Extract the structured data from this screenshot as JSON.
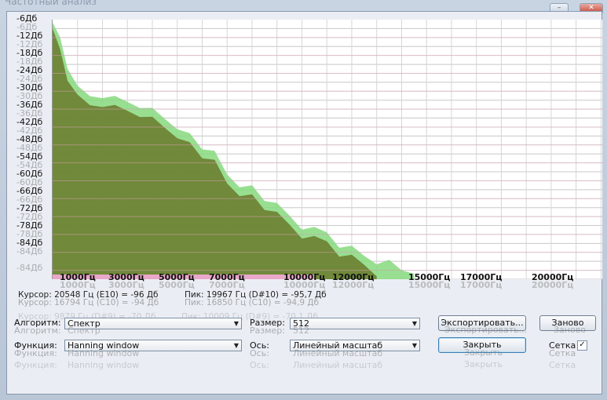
{
  "window": {
    "title": "Частотный анализ",
    "min_glyph": "–",
    "close_glyph": "✕"
  },
  "y_axis": {
    "labels": [
      "-6Дб",
      "-12Дб",
      "-18Дб",
      "-24Дб",
      "-30Дб",
      "-36Дб",
      "-42Дб",
      "-48Дб",
      "-54Дб",
      "-60Дб",
      "-66Дб",
      "-72Дб",
      "-78Дб",
      "-84Дб"
    ],
    "ghost_labels": [
      "-6Дб",
      "-12Дб",
      "-18Дб",
      "-24Дб",
      "-30Дб",
      "-36Дб",
      "-42Дб",
      "-48Дб",
      "-54Дб",
      "-60Дб",
      "-66Дб",
      "-72Дб",
      "-78Дб",
      "-84Дб"
    ],
    "bottom_label": "-84Дб"
  },
  "x_axis": {
    "labels": [
      "1000Гц",
      "3000Гц",
      "5000Гц",
      "7000Гц",
      "10000Гц",
      "12000Гц",
      "15000Гц",
      "17000Гц",
      "20000Гц"
    ],
    "ghost_labels": [
      "1000Гц",
      "3000Гц",
      "5000Гц",
      "7000Гц",
      "10000Гц",
      "12000Гц",
      "15000Гц",
      "17000Гц",
      "20000Гц"
    ]
  },
  "readout": {
    "cursor": "Курсор: 20548 Гц (E10) = -96 Дб",
    "peak": "Пик: 19967 Гц (D#10) = -95,7 Дб",
    "ghost_cursor": "Курсор: 16794 Гц (C10) = -94 Дб",
    "ghost_peak": "Пик: 16850 Гц (C10) = -94,9 Дб",
    "ghost_cursor2": "Курсор: 9879 Гц (D#9) = -70 Дб",
    "ghost_peak2": "Пик: 10009 Гц (D#9) = -70,1 Дб"
  },
  "controls": {
    "algorithm_label": "Алгоритм:",
    "algorithm_value": "Спектр",
    "size_label": "Размер:",
    "size_value": "512",
    "function_label": "Функция:",
    "function_value": "Hanning window",
    "axis_label": "Ось:",
    "axis_value": "Линейный масштаб",
    "export_label": "Экспортировать...",
    "replot_label": "Заново",
    "close_label": "Закрыть",
    "grid_label": "Сетка",
    "grid_checked": true,
    "check_glyph": "✓"
  },
  "chart_data": {
    "type": "area",
    "xlabel": "",
    "ylabel": "",
    "xlim": [
      0,
      22050
    ],
    "ylim": [
      -90,
      -3
    ],
    "grid": true,
    "series": [
      {
        "color": "#86d97e",
        "x": [
          0,
          300,
          600,
          1000,
          1500,
          2000,
          2500,
          3000,
          3500,
          4000,
          4500,
          5000,
          5500,
          6000,
          6500,
          7000,
          7500,
          8000,
          8500,
          9000,
          9500,
          10000,
          10500,
          11000,
          11500,
          12000,
          12500,
          13000,
          13500,
          14000,
          14500
        ],
        "values": [
          -4,
          -10,
          -18,
          -26,
          -29,
          -28,
          -30,
          -30,
          -32,
          -34,
          -35,
          -40,
          -42,
          -45,
          -48,
          -55,
          -58,
          -60,
          -63,
          -64,
          -70,
          -72,
          -73,
          -75,
          -78,
          -80,
          -82,
          -84,
          -85,
          -86,
          -88
        ]
      },
      {
        "color": "#6a7a2a",
        "x": [
          0,
          300,
          600,
          1000,
          1500,
          2000,
          2500,
          3000,
          3500,
          4000,
          4500,
          5000,
          5500,
          6000,
          6500,
          7000,
          7500,
          8000,
          8500,
          9000,
          9500,
          10000,
          10500,
          11000,
          11500,
          12000,
          12500,
          13000
        ],
        "values": [
          -6,
          -14,
          -22,
          -29,
          -32,
          -31,
          -33,
          -33,
          -35,
          -37,
          -38,
          -43,
          -45,
          -48,
          -51,
          -58,
          -61,
          -63,
          -66,
          -67,
          -73,
          -75,
          -76,
          -78,
          -81,
          -83,
          -85,
          -88
        ]
      }
    ]
  }
}
